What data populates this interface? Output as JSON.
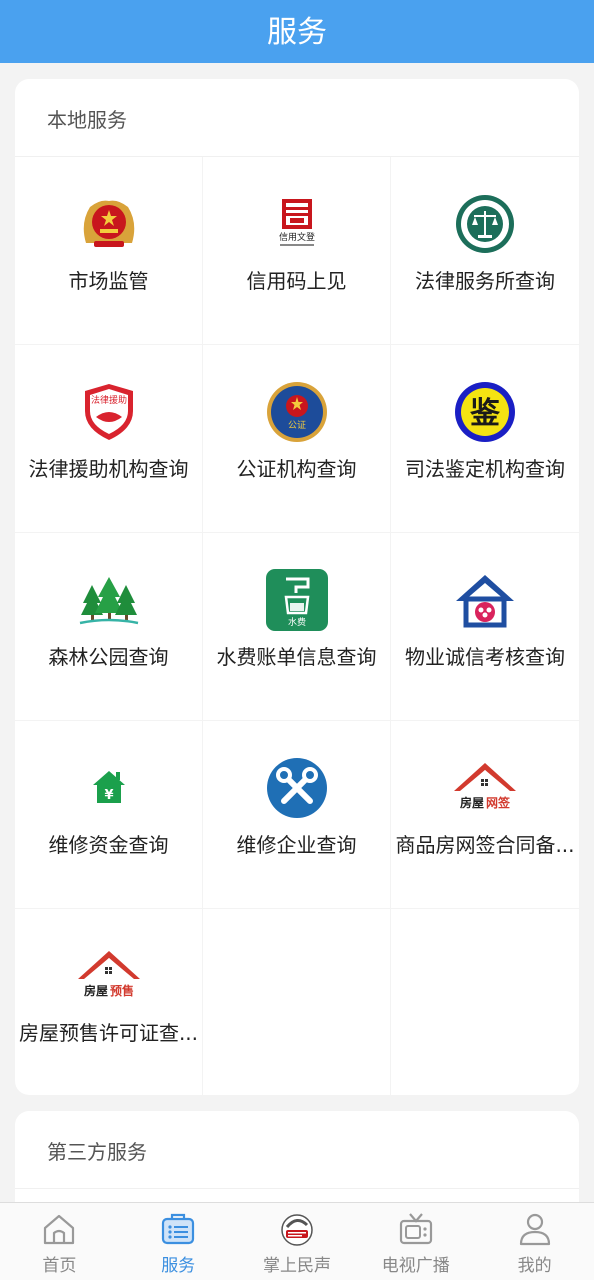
{
  "header": {
    "title": "服务"
  },
  "local": {
    "title": "本地服务",
    "items": [
      {
        "label": "市场监管",
        "icon": "national-emblem-icon"
      },
      {
        "label": "信用码上见",
        "icon": "credit-code-icon",
        "icon_text": "信用文登"
      },
      {
        "label": "法律服务所查询",
        "icon": "legal-service-seal-icon"
      },
      {
        "label": "法律援助机构查询",
        "icon": "legal-aid-shield-icon",
        "icon_text": "法律援助"
      },
      {
        "label": "公证机构查询",
        "icon": "notary-emblem-icon",
        "icon_text": "公证"
      },
      {
        "label": "司法鉴定机构查询",
        "icon": "judicial-appraisal-icon",
        "icon_text": "鉴"
      },
      {
        "label": "森林公园查询",
        "icon": "forest-trees-icon"
      },
      {
        "label": "水费账单信息查询",
        "icon": "water-fee-icon",
        "icon_text": "水费"
      },
      {
        "label": "物业诚信考核查询",
        "icon": "property-house-icon"
      },
      {
        "label": "维修资金查询",
        "icon": "repair-fund-house-icon",
        "icon_text": "¥"
      },
      {
        "label": "维修企业查询",
        "icon": "repair-tools-icon"
      },
      {
        "label": "商品房网签合同备...",
        "icon": "house-sign-icon",
        "icon_text_a": "房屋",
        "icon_text_b": "网签"
      },
      {
        "label": "房屋预售许可证查...",
        "icon": "house-presale-icon",
        "icon_text_a": "房屋",
        "icon_text_b": "预售"
      }
    ]
  },
  "third": {
    "title": "第三方服务"
  },
  "tabs": [
    {
      "label": "首页",
      "icon": "home-icon"
    },
    {
      "label": "服务",
      "icon": "service-list-icon"
    },
    {
      "label": "掌上民声",
      "icon": "people-voice-logo-icon"
    },
    {
      "label": "电视广播",
      "icon": "tv-icon"
    },
    {
      "label": "我的",
      "icon": "profile-icon"
    }
  ],
  "colors": {
    "header": "#4aa1ef",
    "active_tab": "#3b8fe0"
  }
}
